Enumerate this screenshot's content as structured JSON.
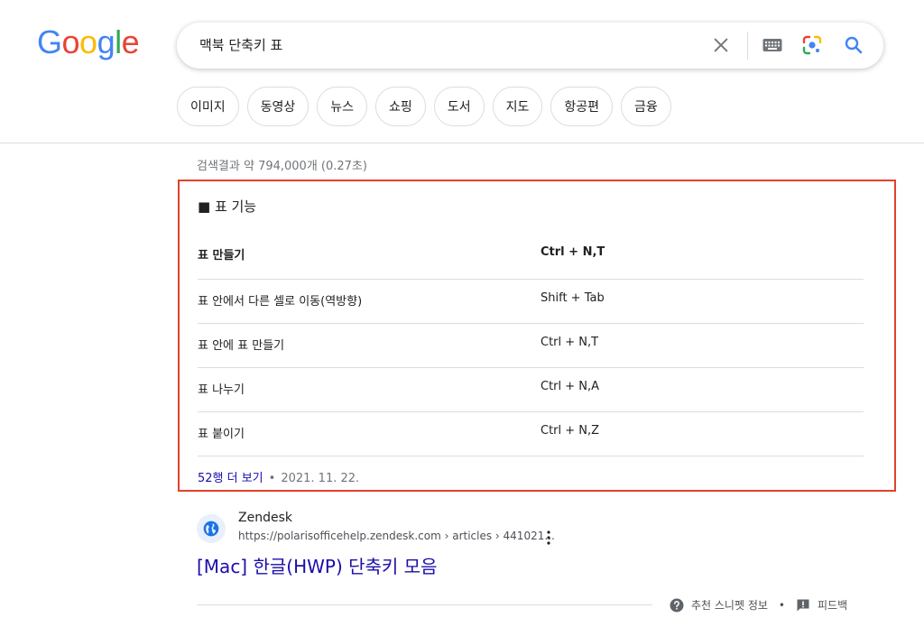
{
  "logo": {
    "letters": [
      "G",
      "o",
      "o",
      "g",
      "l",
      "e"
    ],
    "colors": [
      "#4285F4",
      "#EA4335",
      "#FBBC05",
      "#4285F4",
      "#34A853",
      "#EA4335"
    ]
  },
  "search": {
    "query": "맥북 단축키 표",
    "icons": [
      "close-icon",
      "keyboard-icon",
      "lens-icon",
      "search-icon"
    ]
  },
  "chips": [
    "이미지",
    "동영상",
    "뉴스",
    "쇼핑",
    "도서",
    "지도",
    "항공편",
    "금융"
  ],
  "result_stats": "검색결과 약 794,000개 (0.27초)",
  "snippet": {
    "heading": "■ 표 기능",
    "header_row": {
      "name": "표 만들기",
      "keys": "Ctrl + N,T"
    },
    "rows": [
      {
        "name": "표 안에서 다른 셀로 이동(역방향)",
        "keys": "Shift + Tab"
      },
      {
        "name": "표 안에 표 만들기",
        "keys": "Ctrl + N,T"
      },
      {
        "name": "표 나누기",
        "keys": "Ctrl + N,A"
      },
      {
        "name": "표 붙이기",
        "keys": "Ctrl + N,Z"
      }
    ],
    "more_link": "52행 더 보기",
    "separator": "•",
    "date": "2021. 11. 22.",
    "highlight_color": "#e2412c"
  },
  "result": {
    "site_name": "Zendesk",
    "url": "https://polarisofficehelp.zendesk.com › articles › 441021...",
    "title": "[Mac] 한글(HWP) 단축키 모음"
  },
  "footer": {
    "snippet_info": "추천 스니펫 정보",
    "separator": "•",
    "feedback": "피드백"
  }
}
